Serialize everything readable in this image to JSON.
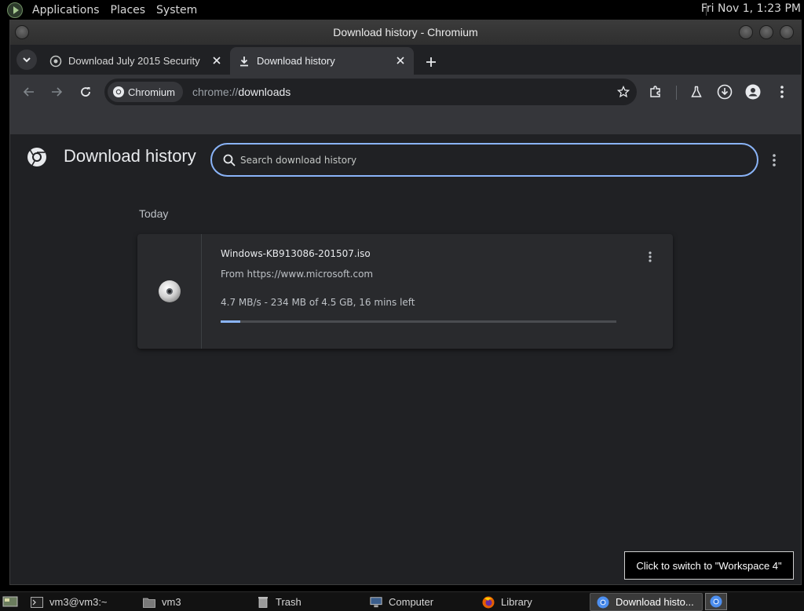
{
  "top_panel": {
    "menus": [
      "Applications",
      "Places",
      "System"
    ],
    "clock": "Fri Nov  1,  1:23 PM"
  },
  "window": {
    "title": "Download history - Chromium"
  },
  "tabs": [
    {
      "title": "Download July 2015 Security",
      "icon": "web-icon",
      "active": false
    },
    {
      "title": "Download history",
      "icon": "download-icon",
      "active": true
    }
  ],
  "omnibox": {
    "chip_label": "Chromium",
    "url_scheme": "chrome://",
    "url_host": "downloads"
  },
  "page": {
    "heading": "Download history",
    "search_placeholder": "Search download history",
    "section_label": "Today",
    "download": {
      "filename": "Windows-KB913086-201507.iso",
      "source": "From https://www.microsoft.com",
      "status": "4.7 MB/s - 234 MB of 4.5 GB, 16 mins left",
      "progress_fraction": 0.05
    }
  },
  "tooltip": "Click to switch to \"Workspace 4\"",
  "taskbar": [
    {
      "label": "vm3@vm3:~",
      "icon": "terminal-icon"
    },
    {
      "label": "vm3",
      "icon": "folder-icon"
    },
    {
      "label": "Trash",
      "icon": "trash-icon"
    },
    {
      "label": "Computer",
      "icon": "computer-icon"
    },
    {
      "label": "Library",
      "icon": "firefox-icon"
    },
    {
      "label": "Download histo...",
      "icon": "chromium-icon",
      "active": true
    }
  ],
  "colors": {
    "accent": "#8ab4f8",
    "page_bg": "#202124",
    "card_bg": "#292a2d"
  }
}
